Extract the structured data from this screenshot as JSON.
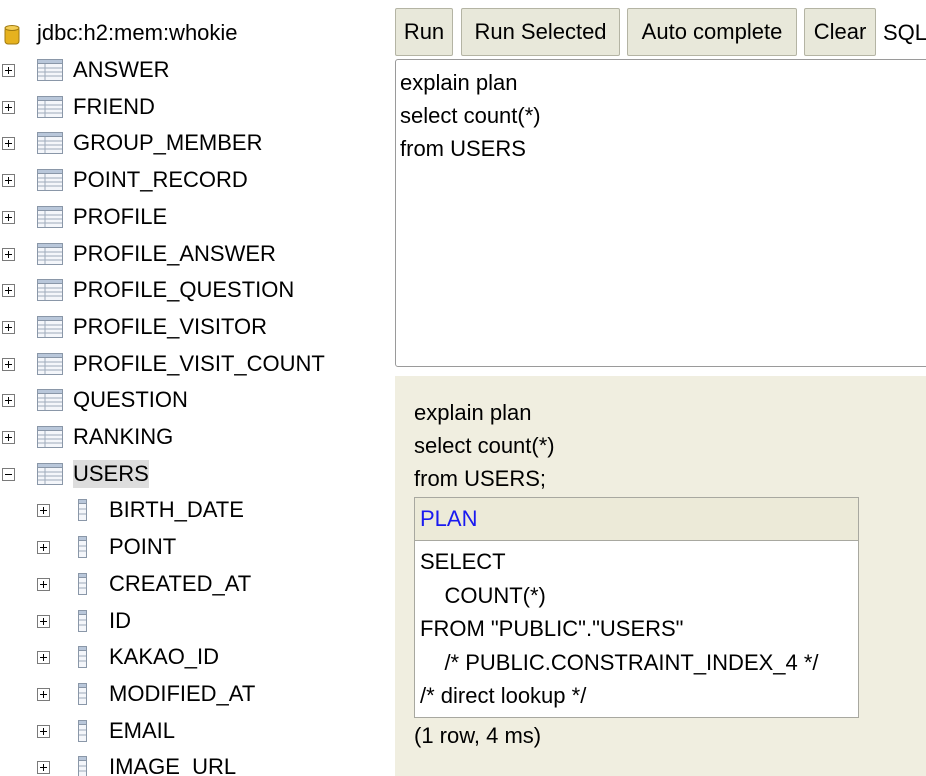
{
  "connection": {
    "label": "jdbc:h2:mem:whokie",
    "icon": "database-icon"
  },
  "tables": [
    {
      "name": "ANSWER",
      "expanded": false
    },
    {
      "name": "FRIEND",
      "expanded": false
    },
    {
      "name": "GROUP_MEMBER",
      "expanded": false
    },
    {
      "name": "POINT_RECORD",
      "expanded": false
    },
    {
      "name": "PROFILE",
      "expanded": false
    },
    {
      "name": "PROFILE_ANSWER",
      "expanded": false
    },
    {
      "name": "PROFILE_QUESTION",
      "expanded": false
    },
    {
      "name": "PROFILE_VISITOR",
      "expanded": false
    },
    {
      "name": "PROFILE_VISIT_COUNT",
      "expanded": false
    },
    {
      "name": "QUESTION",
      "expanded": false
    },
    {
      "name": "RANKING",
      "expanded": false
    },
    {
      "name": "USERS",
      "expanded": true,
      "selected": true
    }
  ],
  "columns": [
    "BIRTH_DATE",
    "POINT",
    "CREATED_AT",
    "ID",
    "KAKAO_ID",
    "MODIFIED_AT",
    "EMAIL",
    "IMAGE_URL"
  ],
  "toolbar": {
    "run": "Run",
    "run_selected": "Run Selected",
    "auto_complete": "Auto complete",
    "clear": "Clear",
    "sql_label": "SQL"
  },
  "editor": {
    "text": "explain plan\nselect count(*)\nfrom USERS"
  },
  "result": {
    "sql": "explain plan\nselect count(*)\nfrom USERS;",
    "header": "PLAN",
    "cell": "SELECT\n    COUNT(*)\nFROM \"PUBLIC\".\"USERS\"\n    /* PUBLIC.CONSTRAINT_INDEX_4 */\n/* direct lookup */",
    "row_info": "(1 row, 4 ms)"
  },
  "colors": {
    "result_bg": "#f0eee0",
    "button_bg": "#e8e8da",
    "plan_header_text": "#1a1af0",
    "selection_bg": "#dddddd"
  }
}
